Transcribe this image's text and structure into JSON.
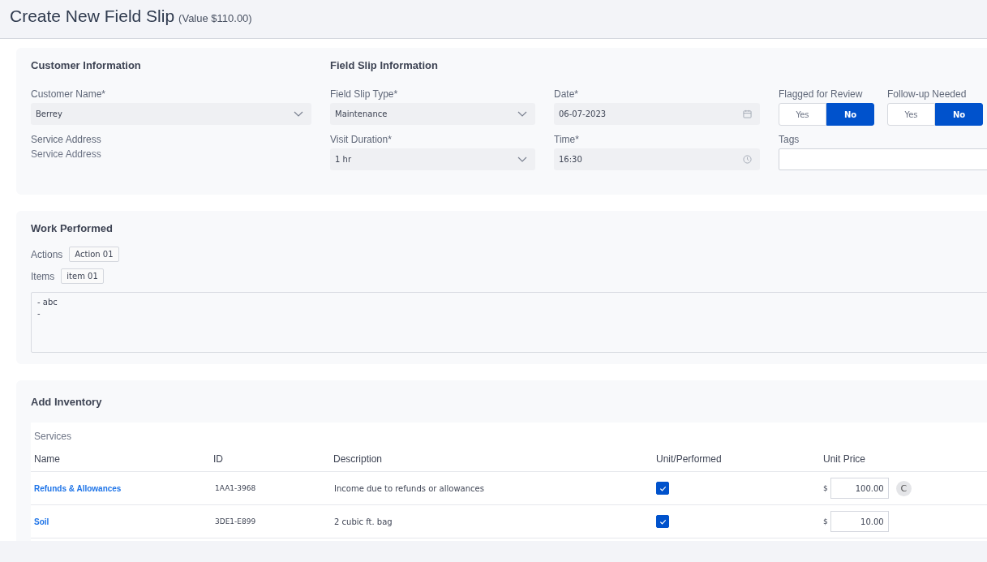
{
  "header": {
    "title": "Create New Field Slip",
    "value": "(Value $110.00)"
  },
  "customer": {
    "heading": "Customer Information",
    "name": {
      "label": "Customer Name*",
      "value": "Berrey"
    },
    "address": {
      "label": "Service Address",
      "value": "Service Address"
    }
  },
  "field_slip": {
    "heading": "Field Slip Information",
    "type": {
      "label": "Field Slip Type*",
      "value": "Maintenance"
    },
    "date": {
      "label": "Date*",
      "value": "06-07-2023"
    },
    "duration": {
      "label": "Visit Duration*",
      "value": "1 hr"
    },
    "time": {
      "label": "Time*",
      "value": "16:30"
    },
    "toggles": [
      {
        "label": "Flagged for Review",
        "options": [
          {
            "label": "Yes",
            "selected": false
          },
          {
            "label": "No",
            "selected": true
          }
        ]
      },
      {
        "label": "Follow-up Needed",
        "options": [
          {
            "label": "Yes",
            "selected": false
          },
          {
            "label": "No",
            "selected": true
          }
        ]
      }
    ],
    "tags": {
      "label": "Tags"
    }
  },
  "work": {
    "heading": "Work Performed",
    "actions": {
      "label": "Actions",
      "chips": [
        "Action 01"
      ]
    },
    "items": {
      "label": "Items",
      "chips": [
        "item 01"
      ]
    },
    "notes": "- abc\n-"
  },
  "inventory": {
    "heading": "Add Inventory",
    "section": "Services",
    "columns": [
      "Name",
      "ID",
      "Description",
      "Unit/Performed",
      "Unit Price"
    ],
    "rows": [
      {
        "name": "Refunds & Allowances",
        "id": "1AA1-3968",
        "description": "Income due to refunds or allowances",
        "checked": true,
        "currency": "$",
        "price": "100.00",
        "action": "C"
      },
      {
        "name": "Soil",
        "id": "3DE1-E899",
        "description": "2 cubic ft. bag",
        "checked": true,
        "currency": "$",
        "price": "10.00"
      }
    ]
  }
}
